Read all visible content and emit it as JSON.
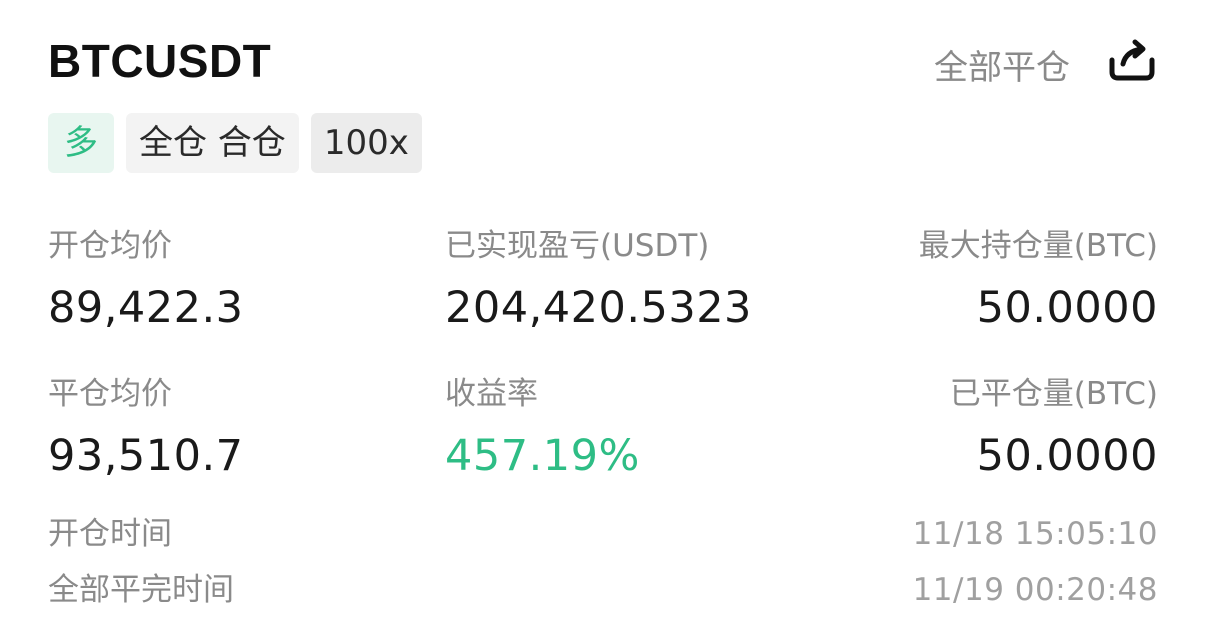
{
  "header": {
    "symbol": "BTCUSDT",
    "close_all_label": "全部平仓",
    "share_icon": "share-icon"
  },
  "tags": {
    "side": "多",
    "margin_mode": "全仓 合仓",
    "leverage": "100x"
  },
  "stats": {
    "open_avg_price": {
      "label": "开仓均价",
      "value": "89,422.3"
    },
    "realized_pnl": {
      "label": "已实现盈亏(USDT)",
      "value": "204,420.5323"
    },
    "max_position": {
      "label": "最大持仓量(BTC)",
      "value": "50.0000"
    },
    "close_avg_price": {
      "label": "平仓均价",
      "value": "93,510.7"
    },
    "roi": {
      "label": "收益率",
      "value": "457.19%"
    },
    "closed_amount": {
      "label": "已平仓量(BTC)",
      "value": "50.0000"
    }
  },
  "times": {
    "open_time": {
      "label": "开仓时间",
      "value": "11/18 15:05:10"
    },
    "close_time": {
      "label": "全部平完时间",
      "value": "11/19 00:20:48"
    }
  },
  "colors": {
    "profit_green": "#2ebd85",
    "label_gray": "#8a8a8a",
    "side_tag_bg": "#e8f6f0"
  }
}
